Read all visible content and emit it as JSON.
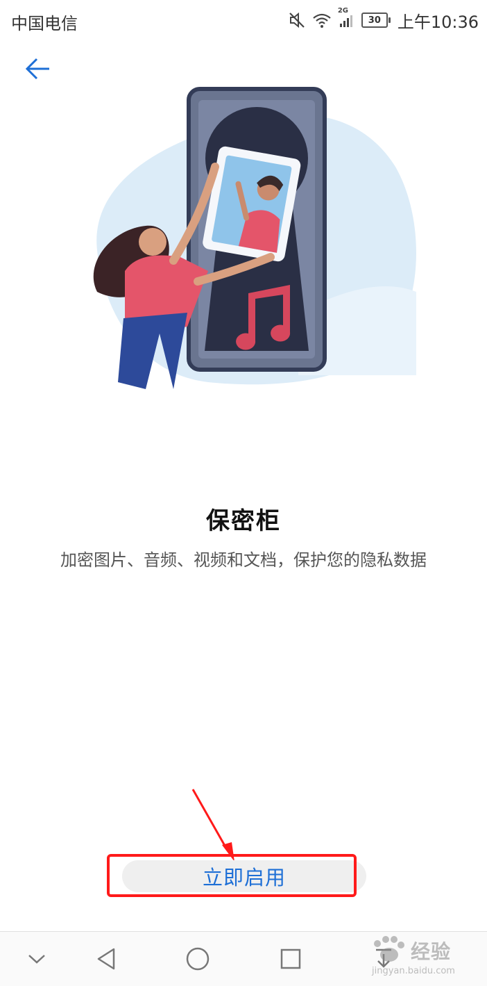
{
  "status_bar": {
    "carrier": "中国电信",
    "battery": "30",
    "network": "2G",
    "time": "上午10:36",
    "icons": [
      "mute-icon",
      "wifi-icon",
      "signal-icon",
      "battery-icon"
    ]
  },
  "nav": {
    "back_icon": "back-arrow-icon"
  },
  "feature": {
    "title": "保密柜",
    "description": "加密图片、音频、视频和文档，保护您的隐私数据"
  },
  "actions": {
    "enable_label": "立即启用"
  },
  "system_nav": {
    "items": [
      "collapse-icon",
      "back-triangle-icon",
      "home-circle-icon",
      "recents-square-icon",
      "download-icon"
    ]
  },
  "watermark": {
    "brand": "经验",
    "domain": "jingyan.baidu.com"
  },
  "colors": {
    "accent": "#1e6fd6",
    "annotation": "#ff1a1a",
    "illustration_blue": "#dcecf8"
  }
}
